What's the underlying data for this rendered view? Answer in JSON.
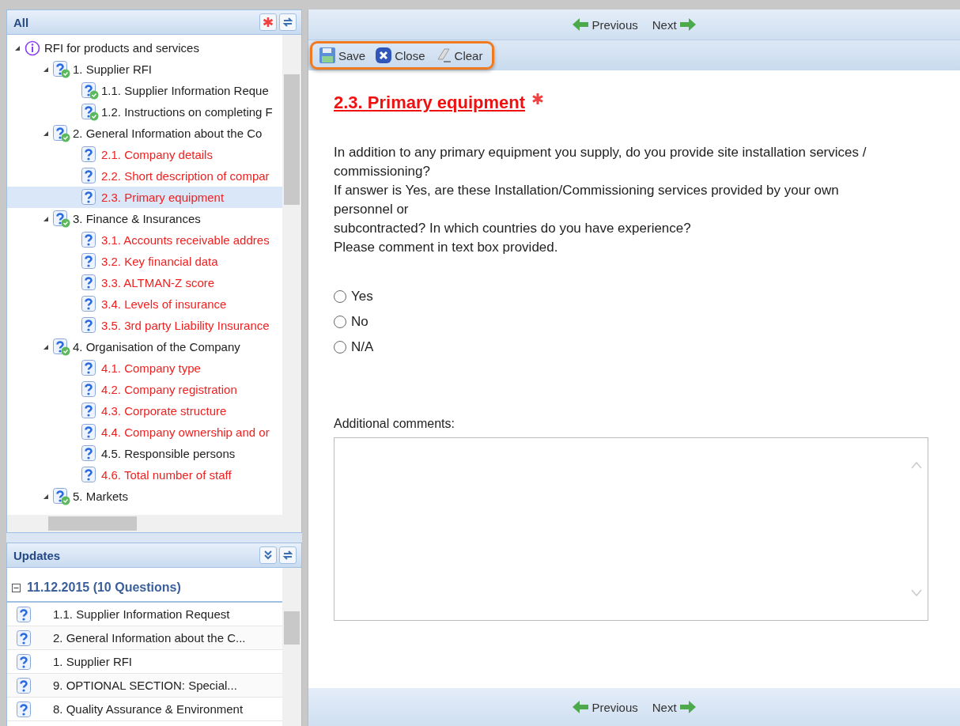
{
  "tree_panel": {
    "title": "All",
    "tools": [
      {
        "kind": "asterisk"
      },
      {
        "kind": "refresh"
      }
    ]
  },
  "tree": [
    {
      "label": "RFI for products and services",
      "kind": "info",
      "expanded": true,
      "selected": false,
      "children": [
        {
          "label": "1. Supplier RFI",
          "kind": "question",
          "checked": true,
          "incomplete": false,
          "expanded": true,
          "selected": false,
          "children": [
            {
              "label": "1.1. Supplier Information Reque",
              "kind": "question",
              "checked": true,
              "incomplete": false,
              "selected": false
            },
            {
              "label": "1.2. Instructions on completing F",
              "kind": "question",
              "checked": true,
              "incomplete": false,
              "selected": false
            }
          ]
        },
        {
          "label": "2. General Information about the Co",
          "kind": "question",
          "checked": true,
          "incomplete": false,
          "expanded": true,
          "selected": false,
          "children": [
            {
              "label": "2.1. Company details",
              "kind": "question",
              "checked": false,
              "incomplete": true,
              "selected": false
            },
            {
              "label": "2.2. Short description of compar",
              "kind": "question",
              "checked": false,
              "incomplete": true,
              "selected": false
            },
            {
              "label": "2.3. Primary equipment",
              "kind": "question",
              "checked": false,
              "incomplete": true,
              "selected": true
            }
          ]
        },
        {
          "label": "3. Finance & Insurances",
          "kind": "question",
          "checked": true,
          "incomplete": false,
          "expanded": true,
          "selected": false,
          "children": [
            {
              "label": "3.1. Accounts receivable addres",
              "kind": "question",
              "checked": false,
              "incomplete": true,
              "selected": false
            },
            {
              "label": "3.2. Key financial data",
              "kind": "question",
              "checked": false,
              "incomplete": true,
              "selected": false
            },
            {
              "label": "3.3. ALTMAN-Z score",
              "kind": "question",
              "checked": false,
              "incomplete": true,
              "selected": false
            },
            {
              "label": "3.4. Levels of insurance",
              "kind": "question",
              "checked": false,
              "incomplete": true,
              "selected": false
            },
            {
              "label": "3.5. 3rd party Liability Insurance",
              "kind": "question",
              "checked": false,
              "incomplete": true,
              "selected": false
            }
          ]
        },
        {
          "label": "4. Organisation of the Company",
          "kind": "question",
          "checked": true,
          "incomplete": false,
          "expanded": true,
          "selected": false,
          "children": [
            {
              "label": "4.1. Company type",
              "kind": "question",
              "checked": false,
              "incomplete": true,
              "selected": false
            },
            {
              "label": "4.2. Company registration",
              "kind": "question",
              "checked": false,
              "incomplete": true,
              "selected": false
            },
            {
              "label": "4.3. Corporate structure",
              "kind": "question",
              "checked": false,
              "incomplete": true,
              "selected": false
            },
            {
              "label": "4.4. Company ownership and or",
              "kind": "question",
              "checked": false,
              "incomplete": true,
              "selected": false
            },
            {
              "label": "4.5. Responsible persons",
              "kind": "question",
              "checked": false,
              "incomplete": false,
              "selected": false
            },
            {
              "label": "4.6. Total number of staff",
              "kind": "question",
              "checked": false,
              "incomplete": true,
              "selected": false
            }
          ]
        },
        {
          "label": "5. Markets",
          "kind": "question",
          "checked": true,
          "incomplete": false,
          "expanded": true,
          "selected": false
        }
      ]
    }
  ],
  "updates_panel": {
    "title": "Updates",
    "tools": [
      {
        "kind": "collapse"
      },
      {
        "kind": "refresh"
      }
    ],
    "group": {
      "label": "11.12.2015 (10 Questions)",
      "expanded": true
    },
    "items": [
      {
        "label": "1.1. Supplier Information Request"
      },
      {
        "label": "2. General Information about the C..."
      },
      {
        "label": "1. Supplier RFI"
      },
      {
        "label": "9. OPTIONAL SECTION: Special..."
      },
      {
        "label": "8. Quality Assurance & Environment"
      }
    ]
  },
  "nav_top": {
    "previous": "Previous",
    "next": "Next"
  },
  "toolbar": {
    "highlighted": true,
    "buttons": [
      {
        "kind": "save",
        "label": "Save"
      },
      {
        "kind": "close",
        "label": "Close"
      },
      {
        "kind": "clear",
        "label": "Clear"
      }
    ]
  },
  "question": {
    "title": "2.3. Primary equipment",
    "required": true,
    "lines": [
      "In addition to any primary equipment you supply, do you provide site installation services /",
      "commissioning?",
      "If answer is Yes, are these Installation/Commissioning services provided by your own",
      "personnel or",
      "subcontracted? In which countries do you have experience?",
      "Please comment in text box provided."
    ],
    "options": [
      {
        "label": "Yes",
        "selected": false
      },
      {
        "label": "No",
        "selected": false
      },
      {
        "label": "N/A",
        "selected": false
      }
    ],
    "comments_label": "Additional comments:"
  },
  "nav_bottom": {
    "previous": "Previous",
    "next": "Next"
  }
}
